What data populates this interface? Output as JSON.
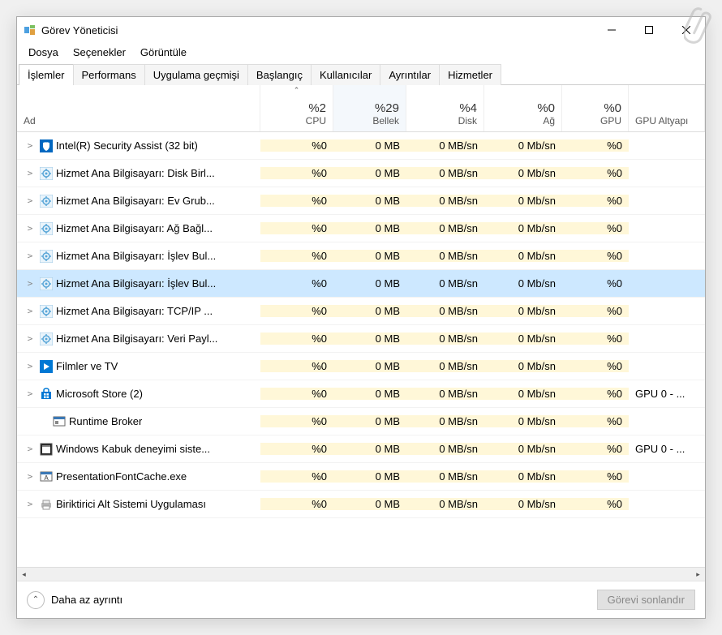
{
  "window": {
    "title": "Görev Yöneticisi"
  },
  "menubar": {
    "items": [
      "Dosya",
      "Seçenekler",
      "Görüntüle"
    ]
  },
  "tabs": {
    "items": [
      "İşlemler",
      "Performans",
      "Uygulama geçmişi",
      "Başlangıç",
      "Kullanıcılar",
      "Ayrıntılar",
      "Hizmetler"
    ],
    "active": 0
  },
  "columns": {
    "name": {
      "label": "Ad"
    },
    "cpu": {
      "value": "%2",
      "label": "CPU"
    },
    "mem": {
      "value": "%29",
      "label": "Bellek",
      "sorted": true
    },
    "disk": {
      "value": "%4",
      "label": "Disk"
    },
    "net": {
      "value": "%0",
      "label": "Ağ"
    },
    "gpu": {
      "value": "%0",
      "label": "GPU"
    },
    "gpue": {
      "label": "GPU Altyapı"
    }
  },
  "rows": [
    {
      "exp": true,
      "icon": "shield",
      "name": "Intel(R) Security Assist (32 bit)",
      "cpu": "%0",
      "mem": "0 MB",
      "disk": "0 MB/sn",
      "net": "0 Mb/sn",
      "gpu": "%0",
      "gpue": ""
    },
    {
      "exp": true,
      "icon": "gear",
      "name": "Hizmet Ana Bilgisayarı: Disk Birl...",
      "cpu": "%0",
      "mem": "0 MB",
      "disk": "0 MB/sn",
      "net": "0 Mb/sn",
      "gpu": "%0",
      "gpue": ""
    },
    {
      "exp": true,
      "icon": "gear",
      "name": "Hizmet Ana Bilgisayarı: Ev Grub...",
      "cpu": "%0",
      "mem": "0 MB",
      "disk": "0 MB/sn",
      "net": "0 Mb/sn",
      "gpu": "%0",
      "gpue": ""
    },
    {
      "exp": true,
      "icon": "gear",
      "name": "Hizmet Ana Bilgisayarı: Ağ Bağl...",
      "cpu": "%0",
      "mem": "0 MB",
      "disk": "0 MB/sn",
      "net": "0 Mb/sn",
      "gpu": "%0",
      "gpue": ""
    },
    {
      "exp": true,
      "icon": "gear",
      "name": "Hizmet Ana Bilgisayarı: İşlev Bul...",
      "cpu": "%0",
      "mem": "0 MB",
      "disk": "0 MB/sn",
      "net": "0 Mb/sn",
      "gpu": "%0",
      "gpue": ""
    },
    {
      "exp": true,
      "icon": "gear",
      "name": "Hizmet Ana Bilgisayarı: İşlev Bul...",
      "cpu": "%0",
      "mem": "0 MB",
      "disk": "0 MB/sn",
      "net": "0 Mb/sn",
      "gpu": "%0",
      "gpue": "",
      "selected": true
    },
    {
      "exp": true,
      "icon": "gear",
      "name": "Hizmet Ana Bilgisayarı: TCP/IP ...",
      "cpu": "%0",
      "mem": "0 MB",
      "disk": "0 MB/sn",
      "net": "0 Mb/sn",
      "gpu": "%0",
      "gpue": ""
    },
    {
      "exp": true,
      "icon": "gear",
      "name": "Hizmet Ana Bilgisayarı: Veri Payl...",
      "cpu": "%0",
      "mem": "0 MB",
      "disk": "0 MB/sn",
      "net": "0 Mb/sn",
      "gpu": "%0",
      "gpue": ""
    },
    {
      "exp": true,
      "icon": "app",
      "name": "Filmler ve TV",
      "cpu": "%0",
      "mem": "0 MB",
      "disk": "0 MB/sn",
      "net": "0 Mb/sn",
      "gpu": "%0",
      "gpue": ""
    },
    {
      "exp": true,
      "icon": "store",
      "name": "Microsoft Store (2)",
      "cpu": "%0",
      "mem": "0 MB",
      "disk": "0 MB/sn",
      "net": "0 Mb/sn",
      "gpu": "%0",
      "gpue": "GPU 0 - ..."
    },
    {
      "exp": false,
      "icon": "rt",
      "name": "Runtime Broker",
      "cpu": "%0",
      "mem": "0 MB",
      "disk": "0 MB/sn",
      "net": "0 Mb/sn",
      "gpu": "%0",
      "gpue": "",
      "child": true
    },
    {
      "exp": true,
      "icon": "shell",
      "name": "Windows Kabuk deneyimi siste...",
      "cpu": "%0",
      "mem": "0 MB",
      "disk": "0 MB/sn",
      "net": "0 Mb/sn",
      "gpu": "%0",
      "gpue": "GPU 0 - ..."
    },
    {
      "exp": true,
      "icon": "font",
      "name": "PresentationFontCache.exe",
      "cpu": "%0",
      "mem": "0 MB",
      "disk": "0 MB/sn",
      "net": "0 Mb/sn",
      "gpu": "%0",
      "gpue": ""
    },
    {
      "exp": true,
      "icon": "print",
      "name": "Biriktirici Alt Sistemi Uygulaması",
      "cpu": "%0",
      "mem": "0 MB",
      "disk": "0 MB/sn",
      "net": "0 Mb/sn",
      "gpu": "%0",
      "gpue": ""
    }
  ],
  "footer": {
    "fewer": "Daha az ayrıntı",
    "endTask": "Görevi sonlandır"
  }
}
